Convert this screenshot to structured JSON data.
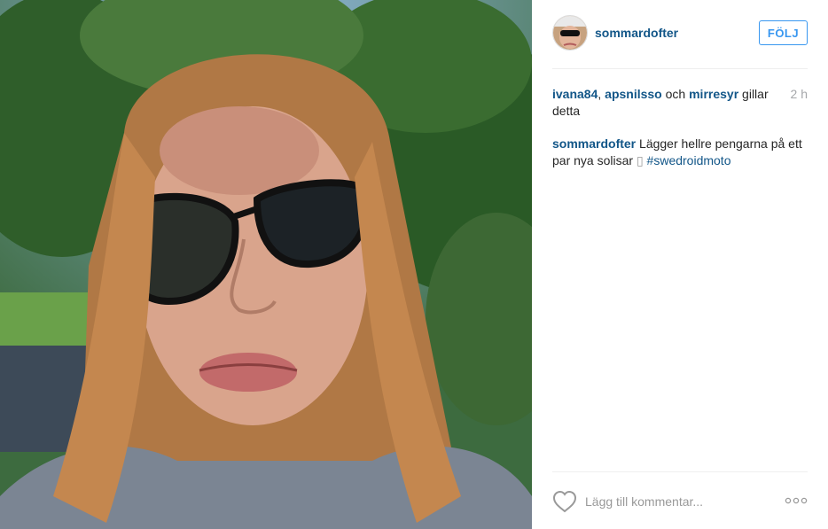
{
  "post": {
    "author": {
      "username": "sommardofter",
      "avatar_icon": "user-avatar-sunglasses"
    },
    "follow_button_label": "FÖLJ",
    "likes": {
      "users": [
        "ivana84",
        "apsnilsso",
        "mirresyr"
      ],
      "separator_comma": ", ",
      "conjunction": " och ",
      "suffix": " gillar detta"
    },
    "timestamp": "2 h",
    "caption": {
      "username": "sommardofter",
      "text": " Lägger hellre pengarna på ett par nya solisar ",
      "emoji_placeholder": "▯",
      "hashtag": "#swedroidmoto"
    },
    "comment": {
      "placeholder": "Lägg till kommentar..."
    },
    "icons": {
      "like": "heart-outline-icon",
      "more": "more-options-icon"
    }
  },
  "colors": {
    "link": "#125688",
    "follow": "#3897f0",
    "timestamp": "#a5a7aa",
    "divider": "#efefef"
  }
}
